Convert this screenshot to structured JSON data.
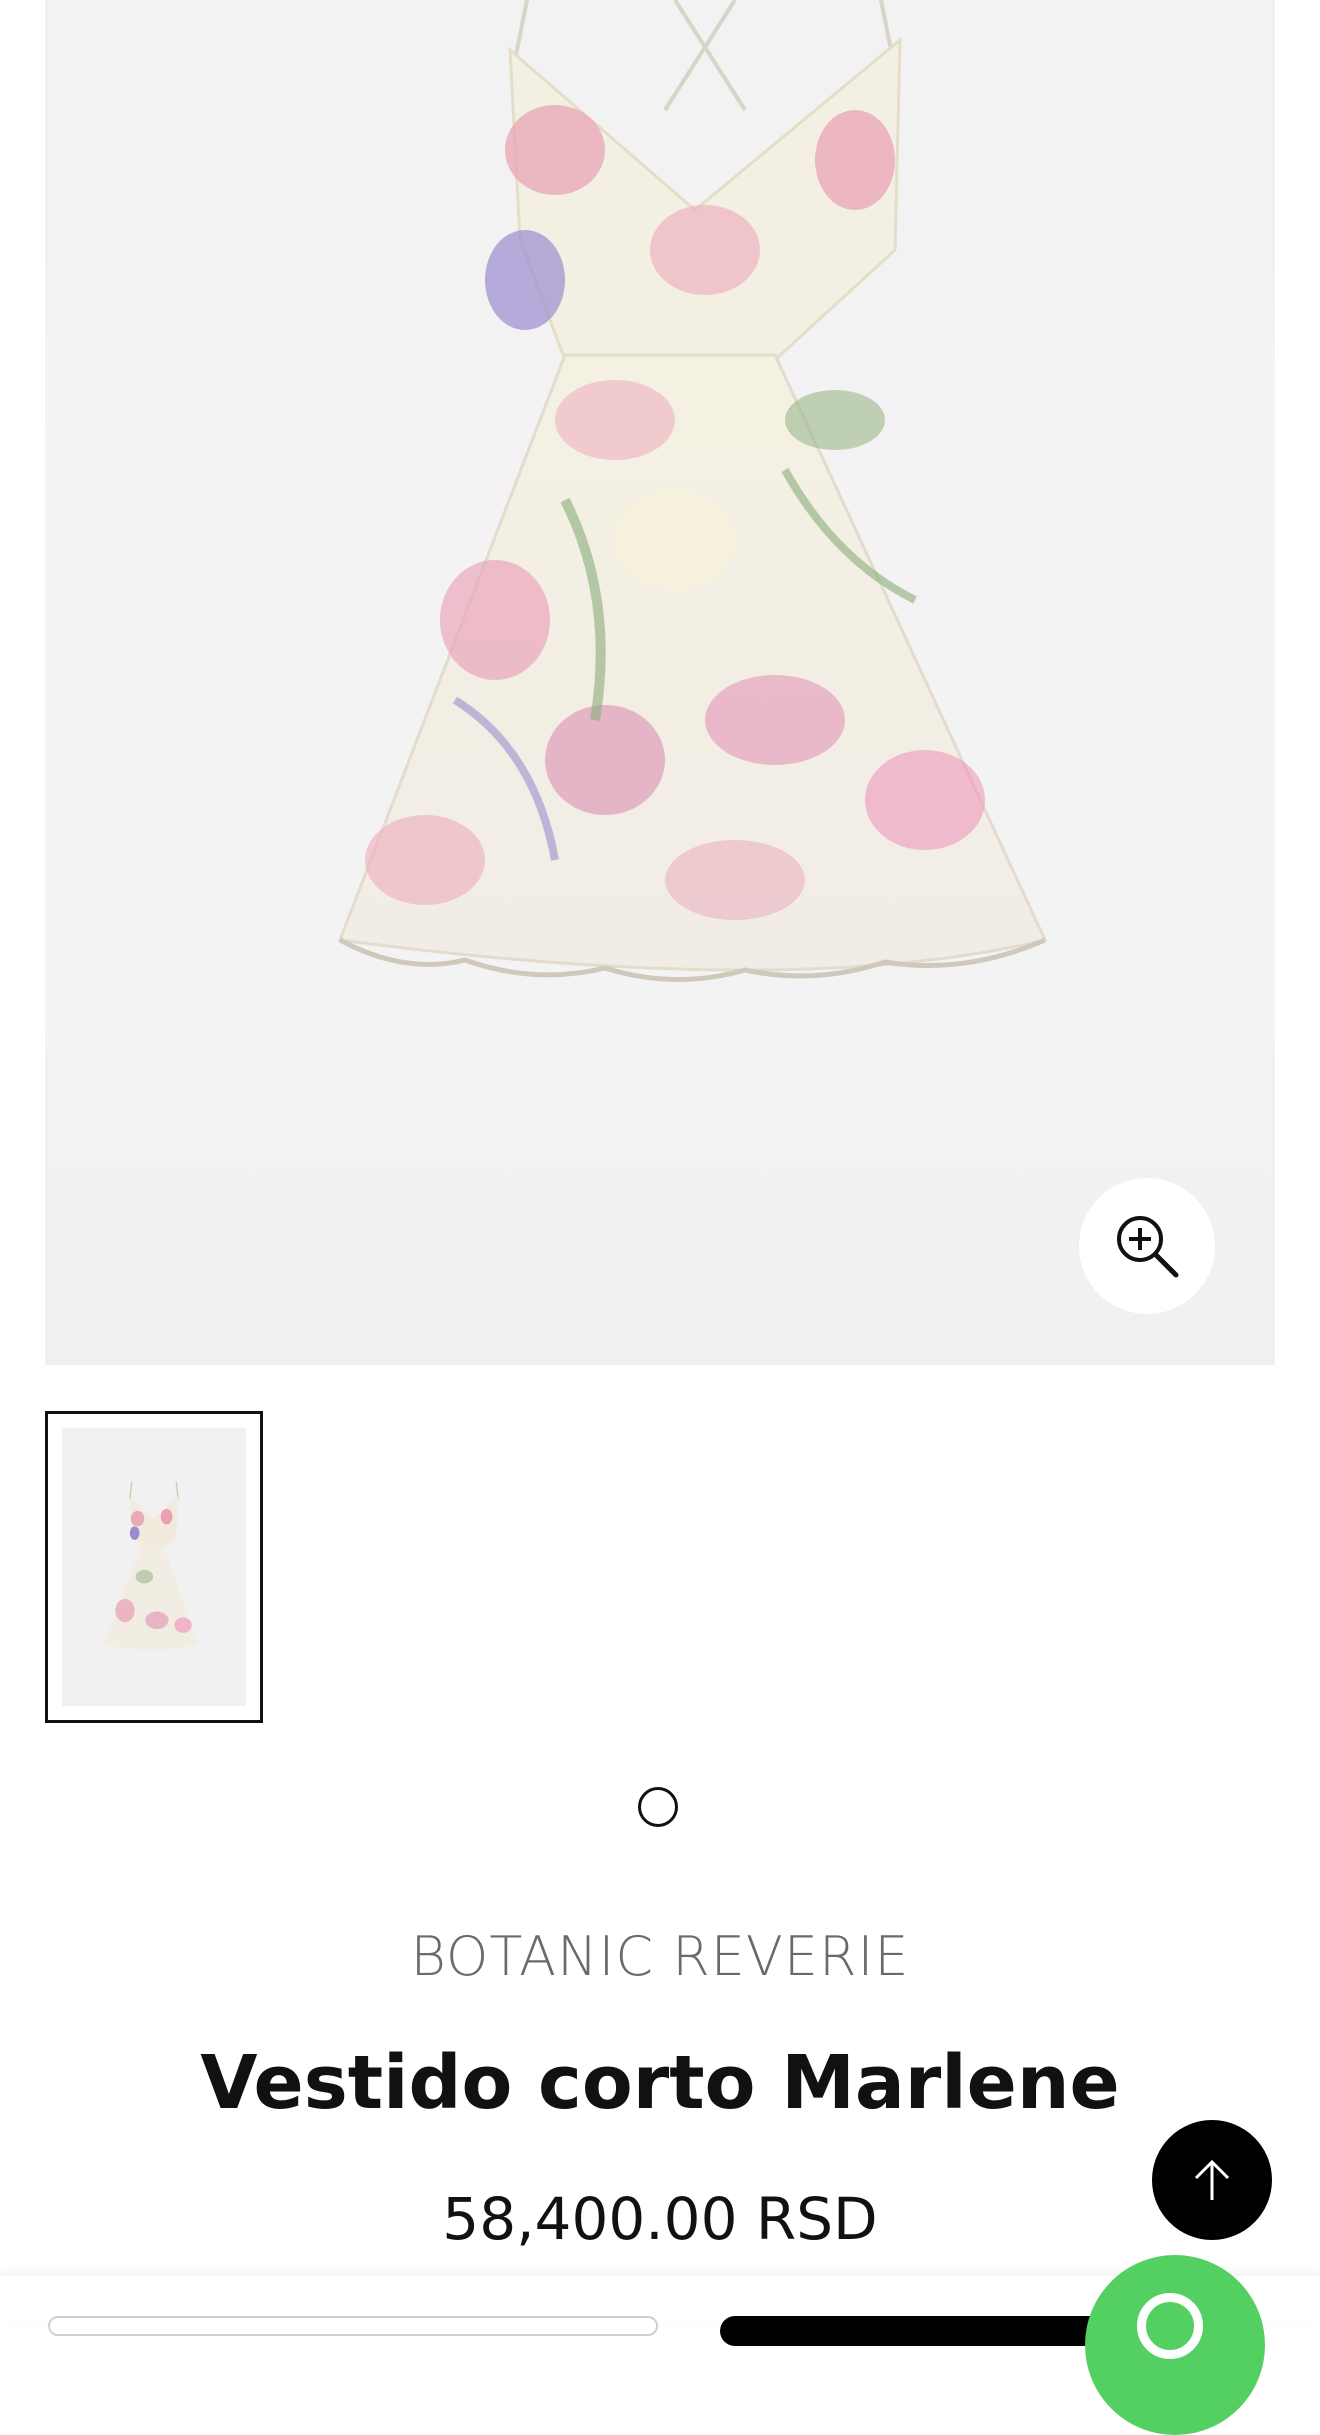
{
  "product": {
    "brand": "BOTANIC REVERIE",
    "title": "Vestido corto Marlene",
    "price": "58,400.00 RSD"
  },
  "gallery": {
    "image_count": 1,
    "active_index": 1
  },
  "icons": {
    "zoom": "zoom-in-icon",
    "scroll_top": "arrow-up-icon",
    "chat": "whatsapp-icon"
  },
  "colors": {
    "chat_green": "#54cf62",
    "scroll_top_bg": "#000000",
    "brand_text": "#6a6a6a"
  }
}
